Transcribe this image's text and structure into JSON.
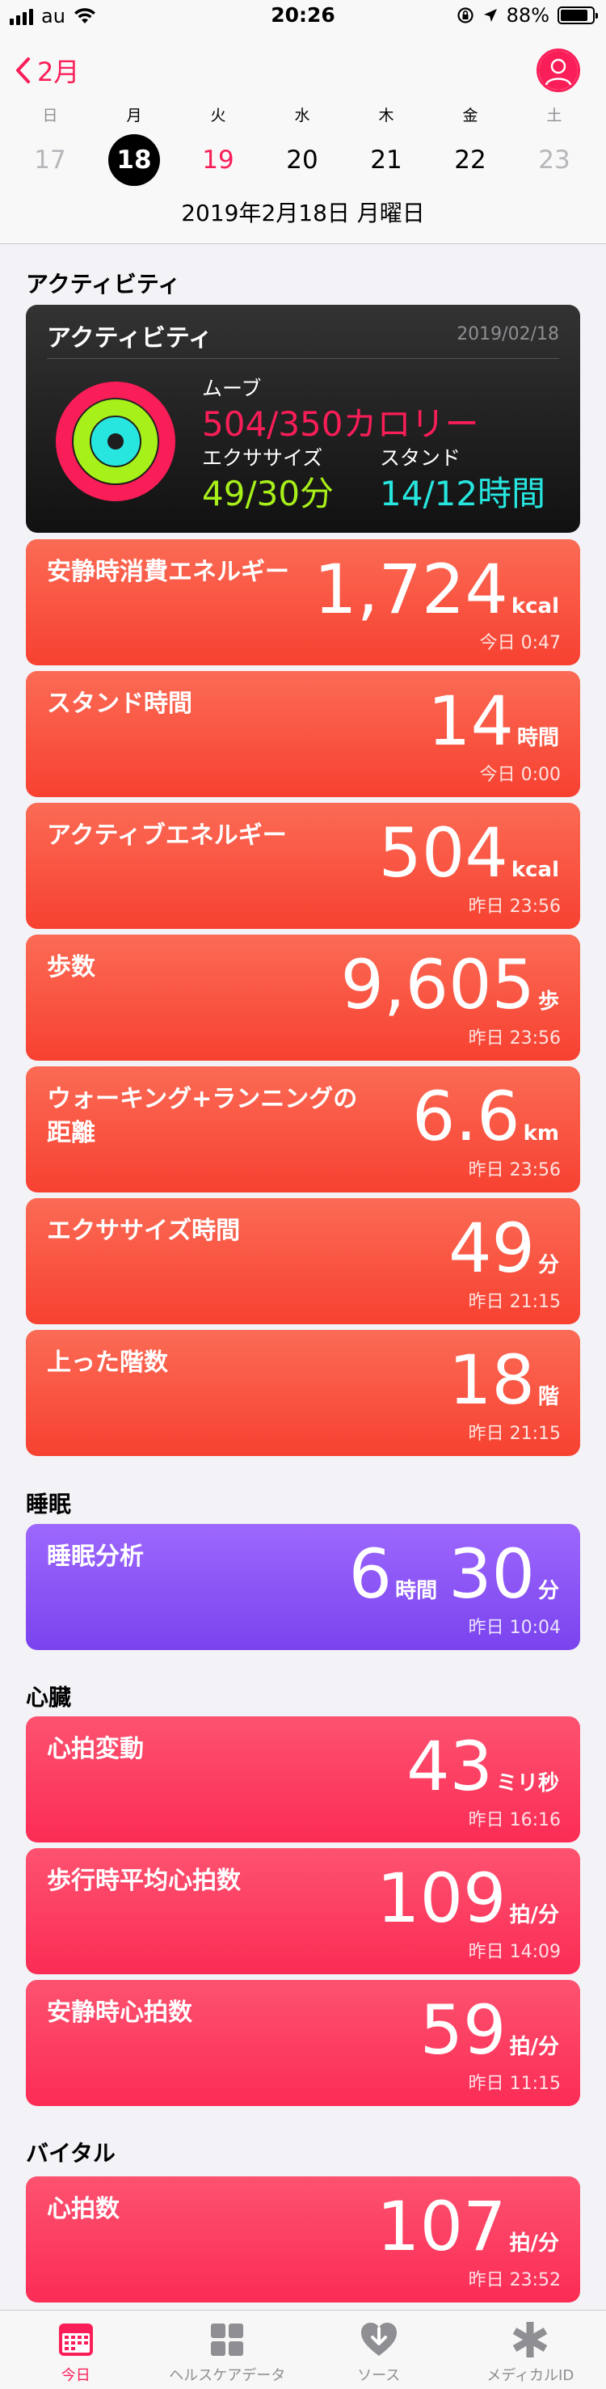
{
  "status_bar": {
    "carrier": "au",
    "time": "20:26",
    "battery": "88%",
    "battery_level": 0.88
  },
  "header": {
    "back_label": "2月",
    "week": [
      {
        "weekday": "日",
        "day": "17",
        "state": "muted"
      },
      {
        "weekday": "月",
        "day": "18",
        "state": "selected"
      },
      {
        "weekday": "火",
        "day": "19",
        "state": "today"
      },
      {
        "weekday": "水",
        "day": "20",
        "state": "normal"
      },
      {
        "weekday": "木",
        "day": "21",
        "state": "normal"
      },
      {
        "weekday": "金",
        "day": "22",
        "state": "normal"
      },
      {
        "weekday": "土",
        "day": "23",
        "state": "muted"
      }
    ],
    "date_title": "2019年2月18日 月曜日"
  },
  "sections": {
    "activity": "アクティビティ",
    "sleep": "睡眠",
    "heart": "心臓",
    "vitals": "バイタル"
  },
  "activity_card": {
    "title": "アクティビティ",
    "date": "2019/02/18",
    "move_label": "ムーブ",
    "move_value": "504/350カロリー",
    "exercise_label": "エクササイズ",
    "exercise_value": "49/30分",
    "stand_label": "スタンド",
    "stand_value": "14/12時間",
    "move_fraction": 1.44,
    "exercise_fraction": 1.63,
    "stand_fraction": 1.17,
    "colors": {
      "move": "#fa1e58",
      "exercise": "#a7f01a",
      "stand": "#27e6e0"
    }
  },
  "cards": {
    "resting_energy": {
      "label": "安静時消費エネルギー",
      "value": "1,724",
      "unit": "kcal",
      "time": "今日 0:47"
    },
    "stand_hours": {
      "label": "スタンド時間",
      "value": "14",
      "unit": "時間",
      "time": "今日 0:00"
    },
    "active_energy": {
      "label": "アクティブエネルギー",
      "value": "504",
      "unit": "kcal",
      "time": "昨日 23:56"
    },
    "steps": {
      "label": "歩数",
      "value": "9,605",
      "unit": "歩",
      "time": "昨日 23:56"
    },
    "distance": {
      "label_line1": "ウォーキング+ランニングの",
      "label_line2": "距離",
      "value": "6.6",
      "unit": "km",
      "time": "昨日 23:56"
    },
    "exercise_time": {
      "label": "エクササイズ時間",
      "value": "49",
      "unit": "分",
      "time": "昨日 21:15"
    },
    "flights": {
      "label": "上った階数",
      "value": "18",
      "unit": "階",
      "time": "昨日 21:15"
    },
    "sleep": {
      "label": "睡眠分析",
      "value_h": "6",
      "unit_h": "時間",
      "value_m": "30",
      "unit_m": "分",
      "time": "昨日 10:04"
    },
    "hrv": {
      "label": "心拍変動",
      "value": "43",
      "unit": "ミリ秒",
      "time": "昨日 16:16"
    },
    "walking_hr": {
      "label": "歩行時平均心拍数",
      "value": "109",
      "unit": "拍/分",
      "time": "昨日 14:09"
    },
    "resting_hr": {
      "label": "安静時心拍数",
      "value": "59",
      "unit": "拍/分",
      "time": "昨日 11:15"
    },
    "heart_rate": {
      "label": "心拍数",
      "value": "107",
      "unit": "拍/分",
      "time": "昨日 23:52"
    }
  },
  "tabs": [
    {
      "label": "今日",
      "icon": "calendar-icon"
    },
    {
      "label": "ヘルスケアデータ",
      "icon": "grid-icon"
    },
    {
      "label": "ソース",
      "icon": "heart-download-icon"
    },
    {
      "label": "メディカルID",
      "icon": "asterisk-icon"
    }
  ],
  "accent_color": "#fa1e58"
}
